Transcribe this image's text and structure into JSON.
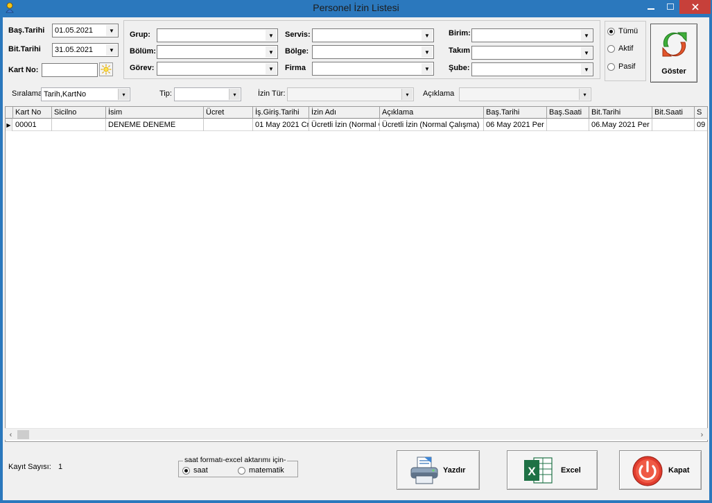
{
  "window": {
    "title": "Personel İzin Listesi"
  },
  "filters": {
    "bas_tarihi_label": "Baş.Tarihi",
    "bas_tarihi_value": "01.05.2021",
    "bit_tarihi_label": "Bit.Tarihi",
    "bit_tarihi_value": "31.05.2021",
    "kart_no_label": "Kart No:",
    "kart_no_value": "",
    "grup_label": "Grup:",
    "bolum_label": "Bölüm:",
    "gorev_label": "Görev:",
    "servis_label": "Servis:",
    "bolge_label": "Bölge:",
    "firma_label": "Firma",
    "birim_label": "Birim:",
    "takim_label": "Takım",
    "sube_label": "Şube:"
  },
  "status_radio": {
    "options": [
      {
        "label": "Tümü",
        "selected": true
      },
      {
        "label": "Aktif",
        "selected": false
      },
      {
        "label": "Pasif",
        "selected": false
      }
    ]
  },
  "goster_button": {
    "label": "Göster"
  },
  "options_bar": {
    "siralama_label": "Sıralama:",
    "siralama_value": "Tarih,KartNo",
    "tip_label": "Tip:",
    "izin_tur_label": "İzin Tür:",
    "aciklama_label": "Açıklama"
  },
  "grid": {
    "columns": [
      "Kart No",
      "Sicilno",
      "İsim",
      "Ücret",
      "İş.Giriş.Tarihi",
      "İzin Adı",
      "Açıklama",
      "Baş.Tarihi",
      "Baş.Saati",
      "Bit.Tarihi",
      "Bit.Saati",
      "S"
    ],
    "rows": [
      [
        "00001",
        "",
        "DENEME DENEME",
        "",
        "01 May 2021 Cm",
        "Ücretli İzin (Normal Ç",
        "Ücretli İzin (Normal Çalışma)",
        "06 May 2021 Per",
        "",
        "06.May 2021 Per",
        "",
        "09"
      ]
    ]
  },
  "footer": {
    "kayit_sayisi_label": "Kayıt Sayısı:",
    "kayit_sayisi_value": "1",
    "excel_format_legend": "saat formatı-excel aktarımı için-",
    "format_options": [
      {
        "label": "saat",
        "selected": true
      },
      {
        "label": "matematik",
        "selected": false
      }
    ],
    "yazdir_label": "Yazdır",
    "excel_label": "Excel",
    "kapat_label": "Kapat"
  },
  "colors": {
    "titlebar": "#2b78bd",
    "close": "#c7403a",
    "client": "#f0f0f0",
    "excel_green": "#1e7145",
    "kapat_red": "#e03c2e"
  }
}
